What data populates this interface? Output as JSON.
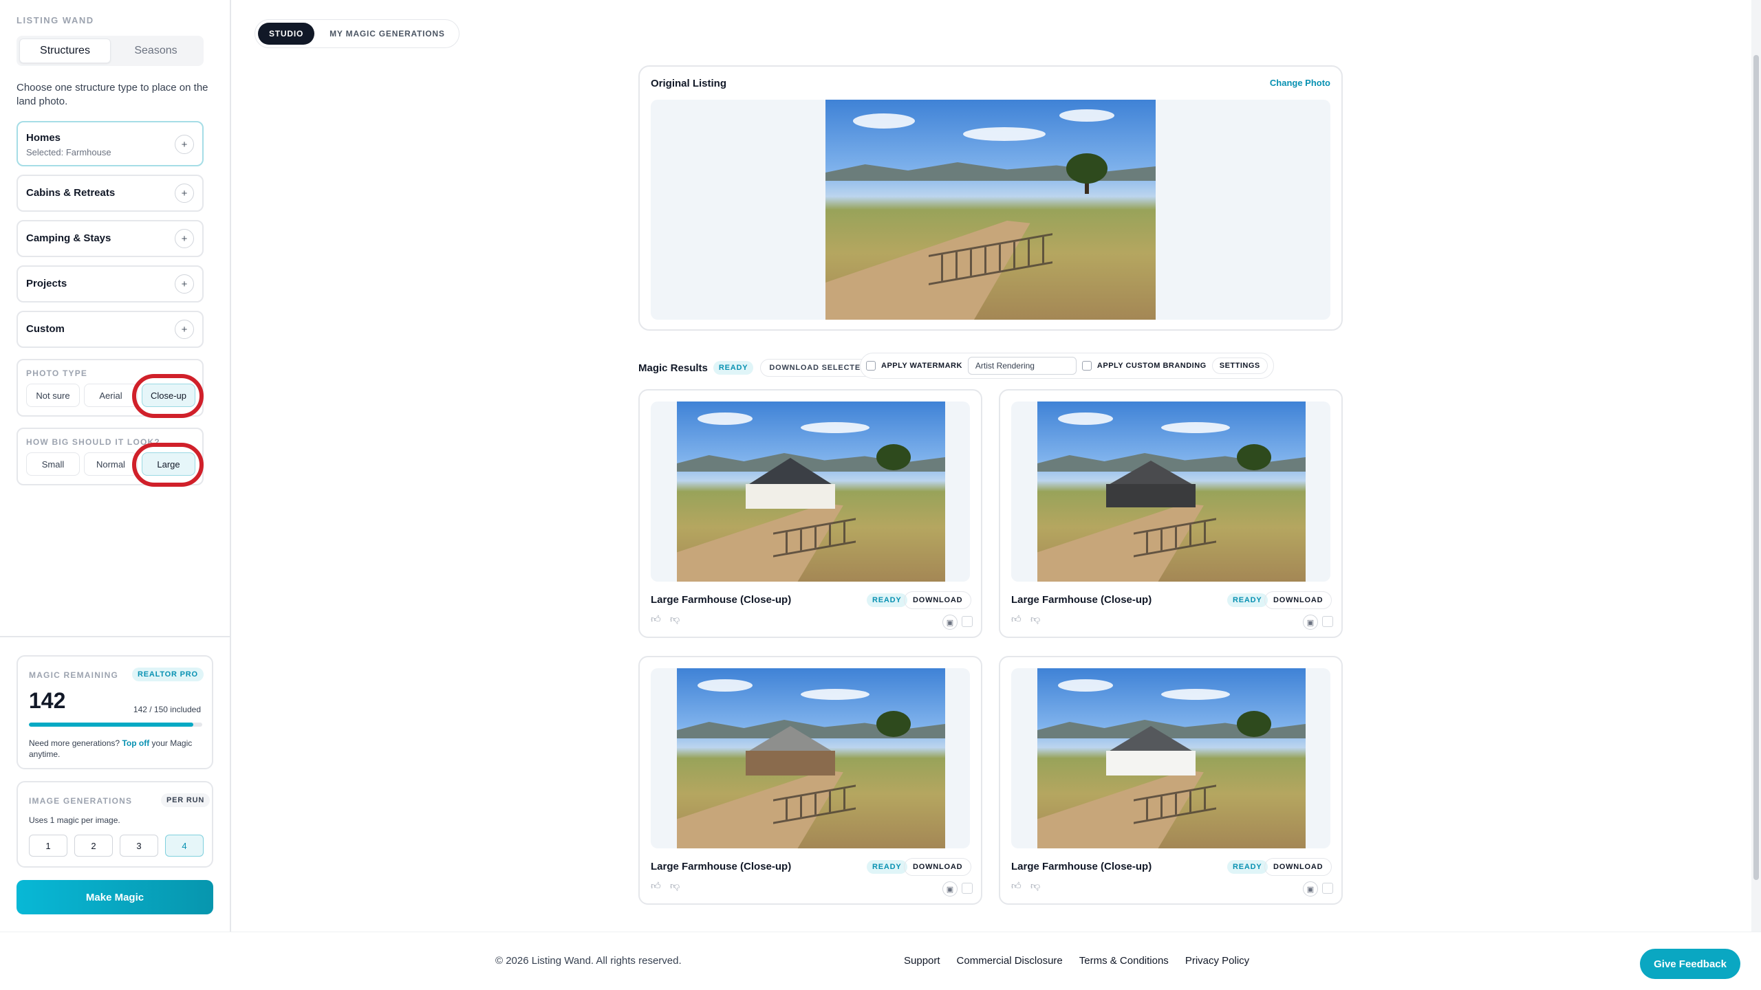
{
  "brand": "LISTING WAND",
  "sidebar": {
    "seg_tabs": [
      {
        "label": "Structures"
      },
      {
        "label": "Seasons"
      }
    ],
    "intro": "Choose one structure type to place on the land photo.",
    "categories": [
      {
        "title": "Homes",
        "subtitle": "Selected: Farmhouse"
      },
      {
        "title": "Cabins & Retreats"
      },
      {
        "title": "Camping & Stays"
      },
      {
        "title": "Projects"
      },
      {
        "title": "Custom"
      }
    ],
    "plus": "+",
    "photo_type": {
      "label": "PHOTO TYPE",
      "options": [
        "Not sure",
        "Aerial",
        "Close-up"
      ],
      "selected": "Close-up"
    },
    "size": {
      "label": "HOW BIG SHOULD IT LOOK?",
      "options": [
        "Small",
        "Normal",
        "Large"
      ],
      "selected": "Large"
    },
    "magic": {
      "label": "MAGIC REMAINING",
      "plan": "REALTOR PRO",
      "remaining": "142",
      "progress_text": "142 / 150 included",
      "progress": 0.9467,
      "note_pre": "Need more generations?",
      "note_link": "Top off",
      "note_post": "your Magic anytime."
    },
    "gen": {
      "label": "IMAGE GENERATIONS",
      "badge": "PER RUN",
      "desc": "Uses 1 magic per image.",
      "options": [
        "1",
        "2",
        "3",
        "4"
      ],
      "selected": "4"
    },
    "make_button": "Make Magic"
  },
  "top_tabs": [
    {
      "label": "STUDIO"
    },
    {
      "label": "MY MAGIC GENERATIONS"
    }
  ],
  "original": {
    "title": "Original Listing",
    "change": "Change Photo"
  },
  "results": {
    "title": "Magic Results",
    "status": "READY",
    "download_selected": "DOWNLOAD SELECTED",
    "watermark_label": "APPLY WATERMARK",
    "watermark_value": "Artist Rendering",
    "branding_label": "APPLY CUSTOM BRANDING",
    "settings": "SETTINGS",
    "cards": [
      {
        "name": "Large Farmhouse (Close-up)",
        "status": "READY",
        "download": "DOWNLOAD"
      },
      {
        "name": "Large Farmhouse (Close-up)",
        "status": "READY",
        "download": "DOWNLOAD"
      },
      {
        "name": "Large Farmhouse (Close-up)",
        "status": "READY",
        "download": "DOWNLOAD"
      },
      {
        "name": "Large Farmhouse (Close-up)",
        "status": "READY",
        "download": "DOWNLOAD"
      }
    ]
  },
  "footer": {
    "copyright": "© 2026 Listing Wand. All rights reserved.",
    "links": [
      "Support",
      "Commercial Disclosure",
      "Terms & Conditions",
      "Privacy Policy"
    ],
    "feedback": "Give Feedback"
  },
  "colors": {
    "accent": "#0aa7c2",
    "highlight_ring": "#d0202a",
    "dark": "#111827"
  }
}
